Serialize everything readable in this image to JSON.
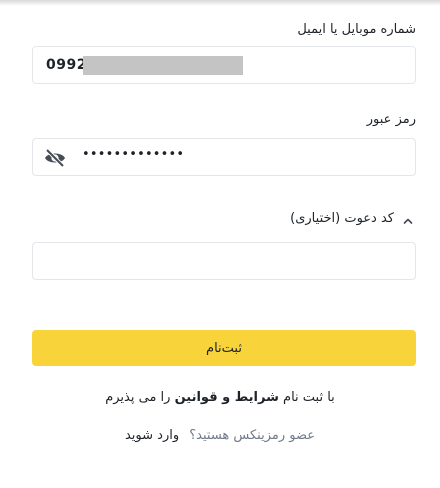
{
  "form": {
    "phone_label": "شماره موبایل یا ایمیل",
    "phone_value": "0992",
    "password_label": "رمز عبور",
    "password_value": "•••••••••••••",
    "invite_label": "کد دعوت (اختیاری)",
    "invite_value": "",
    "submit_label": "ثبت‌نام"
  },
  "footer": {
    "terms_prefix": "با ثبت نام",
    "terms_link": "شرایط و قوانین",
    "terms_suffix": "را می پذیرم",
    "member_question": "عضو رمزینکس هستید؟",
    "login_link": "وارد شوید"
  },
  "icons": {
    "password_toggle": "eye-slash-icon",
    "invite_toggle": "chevron-up-icon"
  },
  "colors": {
    "accent": "#f9d33a",
    "text": "#1e2329",
    "muted": "#707a8a",
    "border": "#e4e6ea"
  }
}
